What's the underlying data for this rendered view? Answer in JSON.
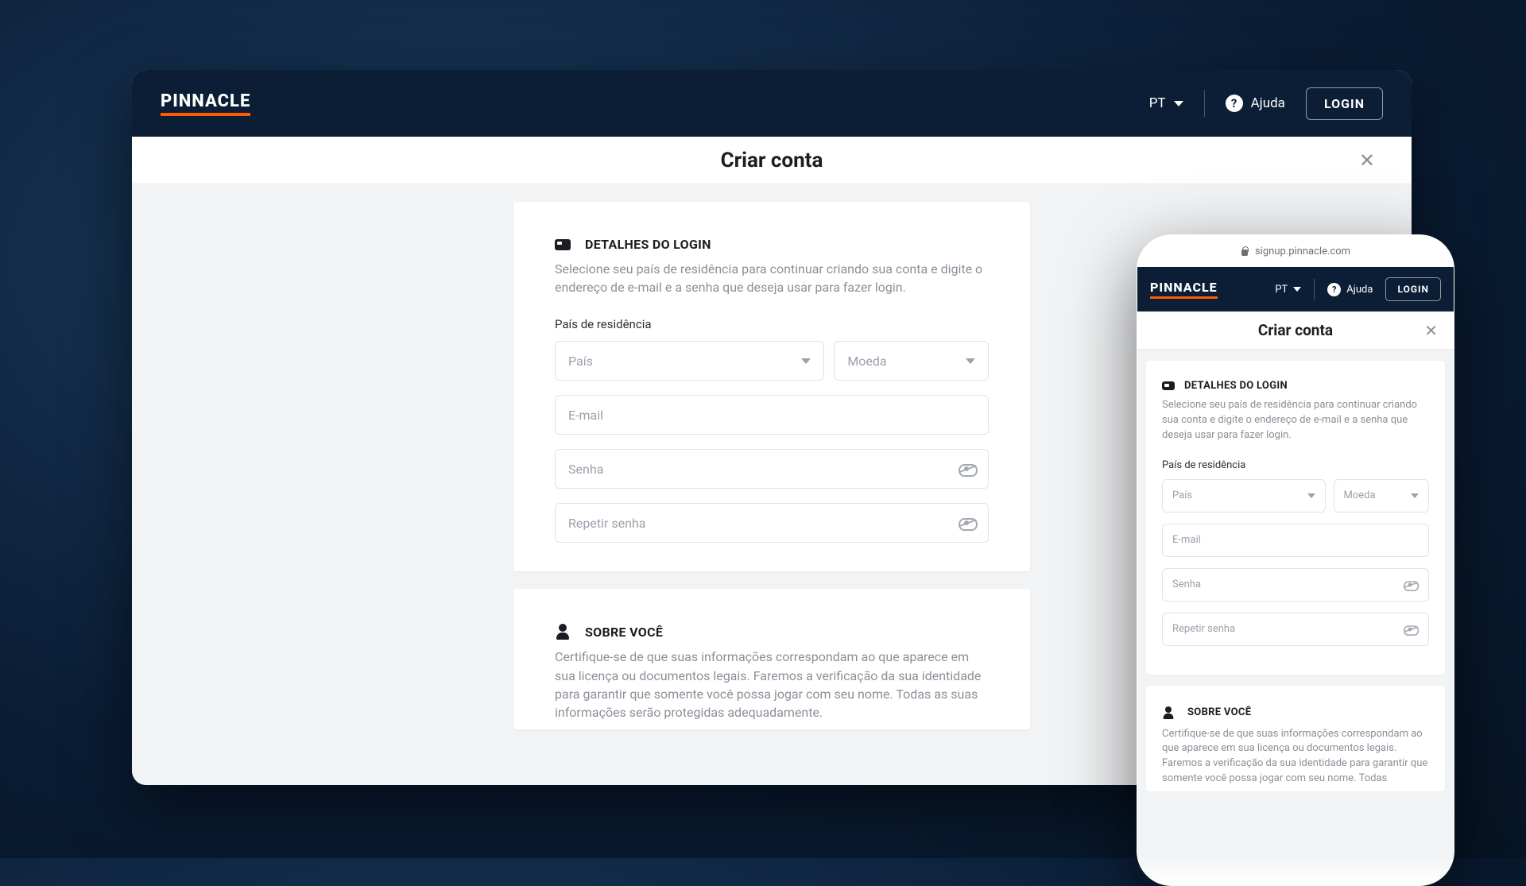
{
  "brand": {
    "name": "PINNACLE",
    "accent": "#ff5c00"
  },
  "header": {
    "language": "PT",
    "help_label": "Ajuda",
    "login_label": "LOGIN"
  },
  "mobile": {
    "address_bar": "signup.pinnacle.com"
  },
  "page": {
    "title": "Criar conta"
  },
  "login_section": {
    "title": "DETALHES DO LOGIN",
    "description": "Selecione seu país de residência para continuar criando sua conta e digite o endereço de e-mail e a senha que deseja usar para fazer login.",
    "residence_label": "País de residência",
    "country_placeholder": "País",
    "currency_placeholder": "Moeda",
    "email_placeholder": "E-mail",
    "password_placeholder": "Senha",
    "repeat_password_placeholder": "Repetir senha"
  },
  "about_section": {
    "title": "SOBRE VOCÊ",
    "description": "Certifique-se de que suas informações correspondam ao que aparece em sua licença ou documentos legais. Faremos a verificação da sua identidade para garantir que somente você possa jogar com seu nome. Todas as suas informações serão protegidas adequadamente."
  },
  "about_section_mobile": {
    "description": "Certifique-se de que suas informações correspondam ao que aparece em sua licença ou documentos legais. Faremos a verificação da sua identidade para garantir que somente você possa jogar com seu nome. Todas"
  }
}
